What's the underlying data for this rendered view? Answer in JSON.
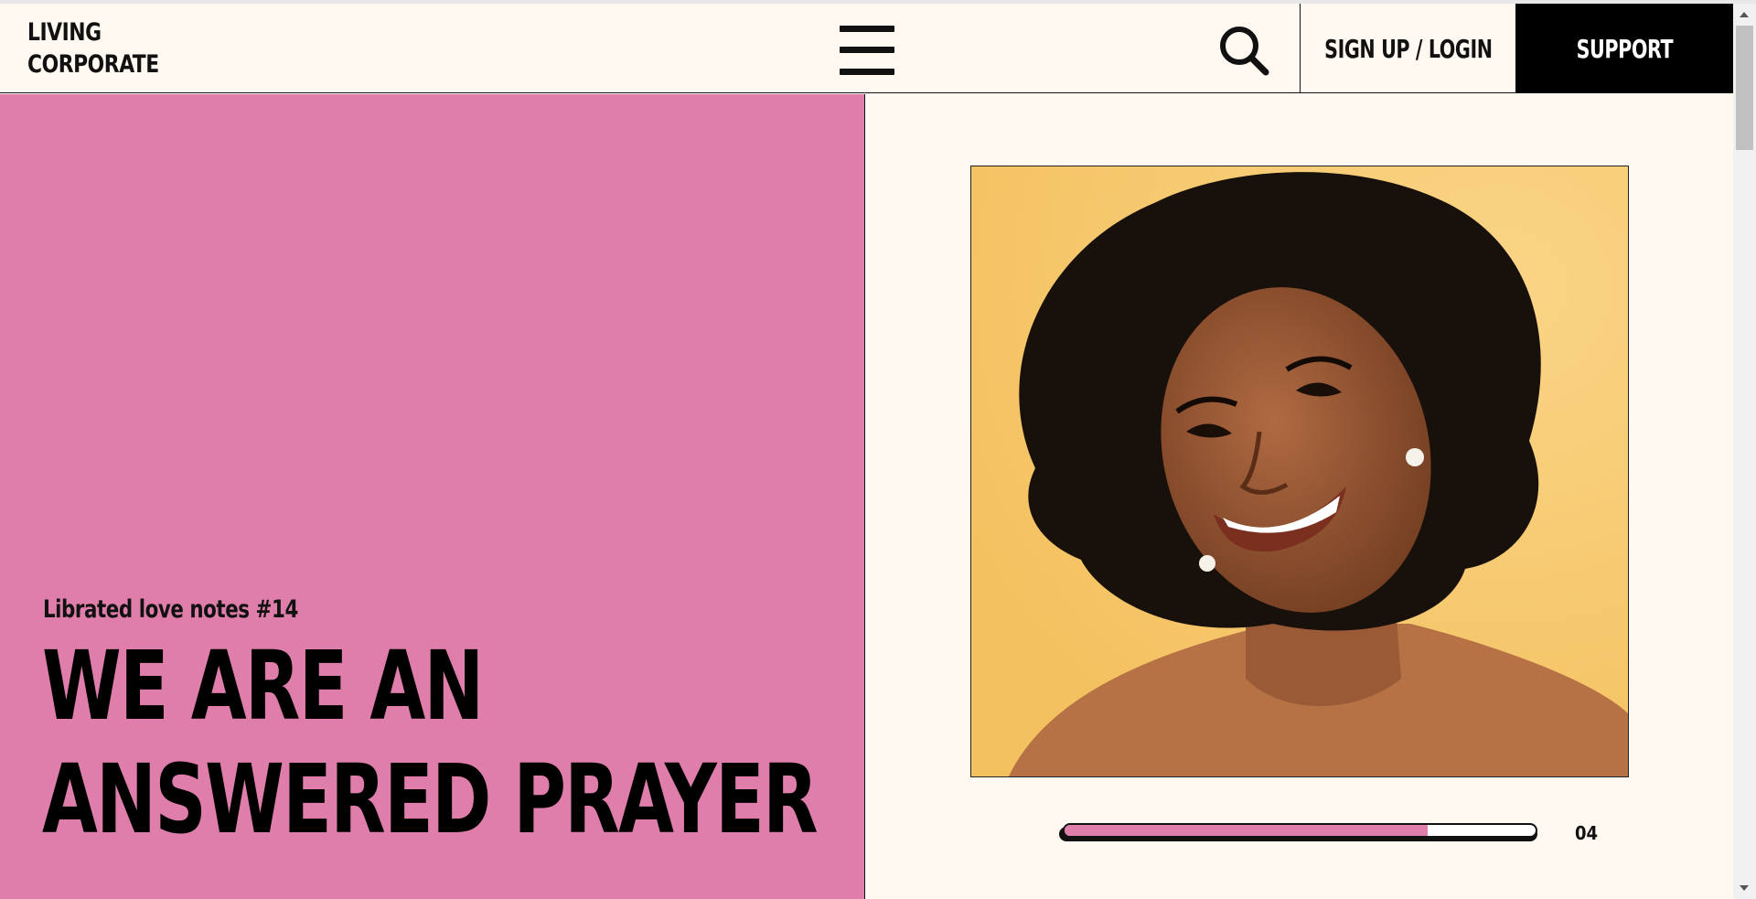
{
  "header": {
    "logo_line1": "LIVING",
    "logo_line2": "CORPORATE",
    "menu_icon": "hamburger-menu-icon",
    "search_icon": "search-icon",
    "login_label": "SIGN UP / LOGIN",
    "support_label": "SUPPORT"
  },
  "hero": {
    "kicker": "Librated love notes #14",
    "headline_line1": "WE ARE AN",
    "headline_line2": "ANSWERED PRAYER",
    "panel_color": "#df7eaa"
  },
  "slider": {
    "image": "portrait-photo",
    "progress_percent": 77,
    "counter": "04"
  },
  "colors": {
    "accent_pink": "#df7eaa",
    "background": "#fff9f2",
    "dark": "#000000",
    "photo_background": "#f7c567"
  }
}
